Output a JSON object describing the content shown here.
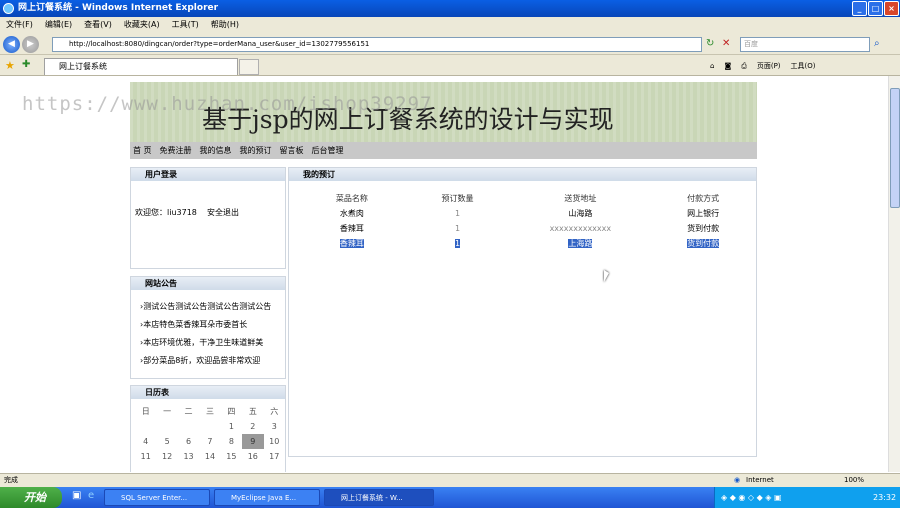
{
  "window": {
    "title": "网上订餐系统 - Windows Internet Explorer"
  },
  "menu": [
    "文件(F)",
    "编辑(E)",
    "查看(V)",
    "收藏夹(A)",
    "工具(T)",
    "帮助(H)"
  ],
  "address": {
    "url": "http://localhost:8080/dingcan/order?type=orderMana_user&user_id=1302779556151"
  },
  "search": {
    "placeholder": "百度"
  },
  "tab": {
    "label": "网上订餐系统"
  },
  "tools": {
    "home": "页面(P)",
    "tools": "工具(O)"
  },
  "watermark": "https://www.huzhan.com/ishop39297",
  "site": {
    "banner": "基于jsp的网上订餐系统的设计与实现",
    "nav": [
      "首 页",
      "免费注册",
      "我的信息",
      "我的预订",
      "留言板",
      "后台管理"
    ],
    "login": {
      "title": "用户登录",
      "welcome": "欢迎您：liu3718",
      "logout": "安全退出"
    },
    "notice": {
      "title": "网站公告",
      "items": [
        "测试公告测试公告测试公告测试公告",
        "本店特色菜香辣耳朵市委首长",
        "本店环境优雅，干净卫生味道鲜美",
        "部分菜品8折，欢迎品尝非常欢迎"
      ]
    },
    "calendar": {
      "title": "日历表",
      "weekdays": [
        "日",
        "一",
        "二",
        "三",
        "四",
        "五",
        "六"
      ],
      "rows": [
        [
          "",
          "",
          "",
          "1",
          "2",
          "3",
          ""
        ],
        [
          "4",
          "5",
          "6",
          "7",
          "8",
          "9",
          "10"
        ],
        [
          "11",
          "12",
          "13",
          "14",
          "15",
          "16",
          "17"
        ]
      ]
    },
    "orders": {
      "title": "我的预订",
      "headers": [
        "菜品名称",
        "预订数量",
        "送货地址",
        "付款方式"
      ],
      "rows": [
        [
          "水煮肉",
          "1",
          "山海路",
          "网上银行"
        ],
        [
          "香辣耳",
          "1",
          "xxxxxxxxxxxxx",
          "货到付款"
        ],
        [
          "香辣耳",
          "1",
          "上海路",
          "货到付款"
        ]
      ]
    }
  },
  "status": {
    "left": "完成",
    "zone": "Internet",
    "zoom": "100%"
  },
  "taskbar": {
    "start": "开始",
    "tasks": [
      "SQL Server Enter...",
      "MyEclipse Java E...",
      "网上订餐系统 - W..."
    ],
    "time": "23:32"
  }
}
